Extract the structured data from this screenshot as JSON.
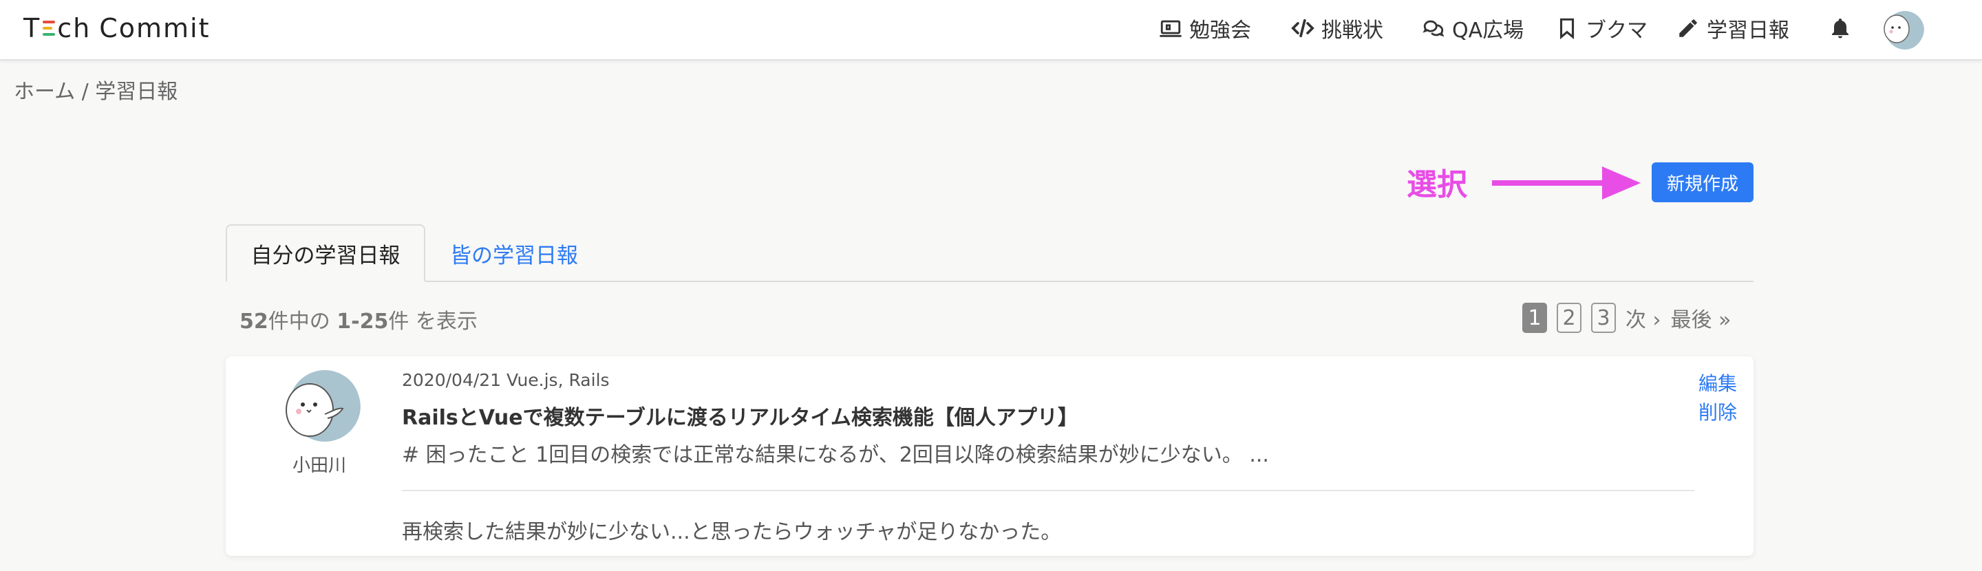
{
  "brand": {
    "pre": "T",
    "post": "ch",
    "word2": "Commit"
  },
  "nav": {
    "study": "勉強会",
    "challenge": "挑戦状",
    "qa": "QA広場",
    "bookmark": "ブクマ",
    "report": "学習日報"
  },
  "breadcrumb": "ホーム / 学習日報",
  "annotation": {
    "label": "選択",
    "color": "#e84de6"
  },
  "new_button": "新規作成",
  "tabs": {
    "mine": "自分の学習日報",
    "all": "皆の学習日報"
  },
  "count": {
    "total": "52",
    "mid": "件中の ",
    "range": "1-25",
    "suffix": "件 を表示"
  },
  "pagination": {
    "pages": [
      "1",
      "2",
      "3"
    ],
    "current": "1",
    "next": "次 ›",
    "last": "最後 »"
  },
  "report": {
    "author": "小田川",
    "meta": "2020/04/21 Vue.js, Rails",
    "title": "RailsとVueで複数テーブルに渡るリアルタイム検索機能【個人アプリ】",
    "excerpt": "# 困ったこと 1回目の検索では正常な結果になるが、2回目以降の検索結果が妙に少ない。 ...",
    "comment": "再検索した結果が妙に少ない...と思ったらウォッチャが足りなかった。",
    "edit": "編集",
    "delete": "削除"
  },
  "colors": {
    "accent": "#2d7bf4",
    "annotation": "#e84de6"
  }
}
